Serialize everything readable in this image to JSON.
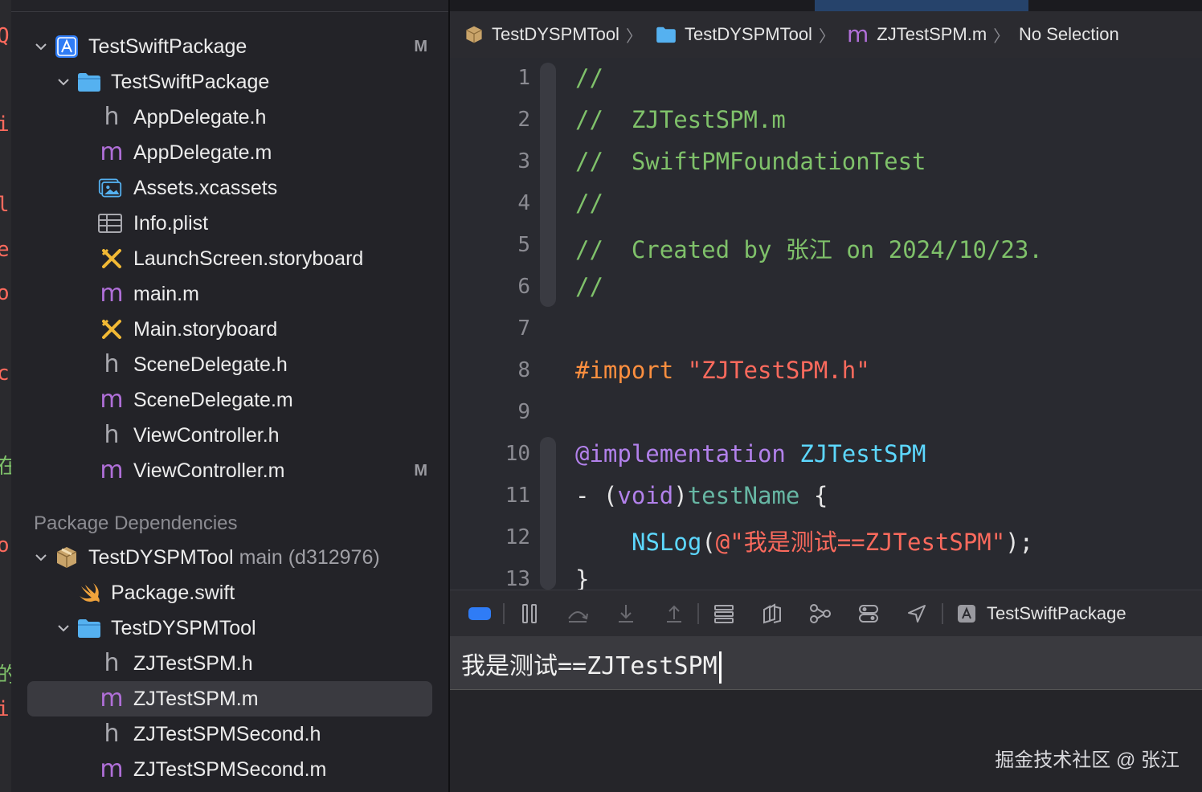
{
  "colors": {
    "accent": "#2f7cf6",
    "obj_m": "#b06fd8",
    "folder": "#55b1f0",
    "selection": "#3a3a40"
  },
  "navigator": {
    "project": {
      "label": "TestSwiftPackage",
      "badge": "M",
      "icon": "app-project-icon"
    },
    "group": {
      "label": "TestSwiftPackage",
      "icon": "folder-icon"
    },
    "files": [
      {
        "icon": "h",
        "label": "AppDelegate.h",
        "badge": ""
      },
      {
        "icon": "m",
        "label": "AppDelegate.m",
        "badge": ""
      },
      {
        "icon": "assets",
        "label": "Assets.xcassets",
        "badge": ""
      },
      {
        "icon": "plist",
        "label": "Info.plist",
        "badge": ""
      },
      {
        "icon": "storyboard",
        "label": "LaunchScreen.storyboard",
        "badge": ""
      },
      {
        "icon": "m",
        "label": "main.m",
        "badge": ""
      },
      {
        "icon": "storyboard",
        "label": "Main.storyboard",
        "badge": ""
      },
      {
        "icon": "h",
        "label": "SceneDelegate.h",
        "badge": ""
      },
      {
        "icon": "m",
        "label": "SceneDelegate.m",
        "badge": ""
      },
      {
        "icon": "h",
        "label": "ViewController.h",
        "badge": ""
      },
      {
        "icon": "m",
        "label": "ViewController.m",
        "badge": "M"
      }
    ],
    "section_title": "Package Dependencies",
    "package": {
      "label": "TestDYSPMTool",
      "detail": "main (d312976)",
      "icon": "package-icon"
    },
    "package_swift": {
      "label": "Package.swift",
      "icon": "swift-icon"
    },
    "package_group": {
      "label": "TestDYSPMTool",
      "icon": "folder-icon"
    },
    "package_files": [
      {
        "icon": "h",
        "label": "ZJTestSPM.h",
        "selected": false
      },
      {
        "icon": "m",
        "label": "ZJTestSPM.m",
        "selected": true
      },
      {
        "icon": "h",
        "label": "ZJTestSPMSecond.h",
        "selected": false
      },
      {
        "icon": "m",
        "label": "ZJTestSPMSecond.m",
        "selected": false
      }
    ],
    "h_letter": "h",
    "m_letter": "m"
  },
  "jumpbar": {
    "items": [
      "TestDYSPMTool",
      "TestDYSPMTool",
      "ZJTestSPM.m",
      "No Selection"
    ],
    "separator": "〉"
  },
  "code": {
    "line_numbers": [
      "1",
      "2",
      "3",
      "4",
      "5",
      "6",
      "7",
      "8",
      "9",
      "10",
      "11",
      "12",
      "13"
    ],
    "l1": "//",
    "l2": "//  ZJTestSPM.m",
    "l3": "//  SwiftPMFoundationTest",
    "l4": "//",
    "l5": "//  Created by 张江 on 2024/10/23.",
    "l6": "//",
    "l8_pre": "#import ",
    "l8_str": "\"ZJTestSPM.h\"",
    "l10_kw": "@implementation",
    "l10_type": "ZJTestSPM",
    "l11_dash": "- (",
    "l11_kw": "void",
    "l11_close": ")",
    "l11_fn": "testName",
    "l11_brace": " {",
    "l12_fn": "NSLog",
    "l12_open": "(",
    "l12_str": "@\"我是测试==ZJTestSPM\"",
    "l12_close": ");",
    "l13": "}"
  },
  "debugbar": {
    "scheme_label": "TestSwiftPackage"
  },
  "console": {
    "output": "我是测试==ZJTestSPM"
  },
  "watermark": "掘金技术社区 @ 张江"
}
